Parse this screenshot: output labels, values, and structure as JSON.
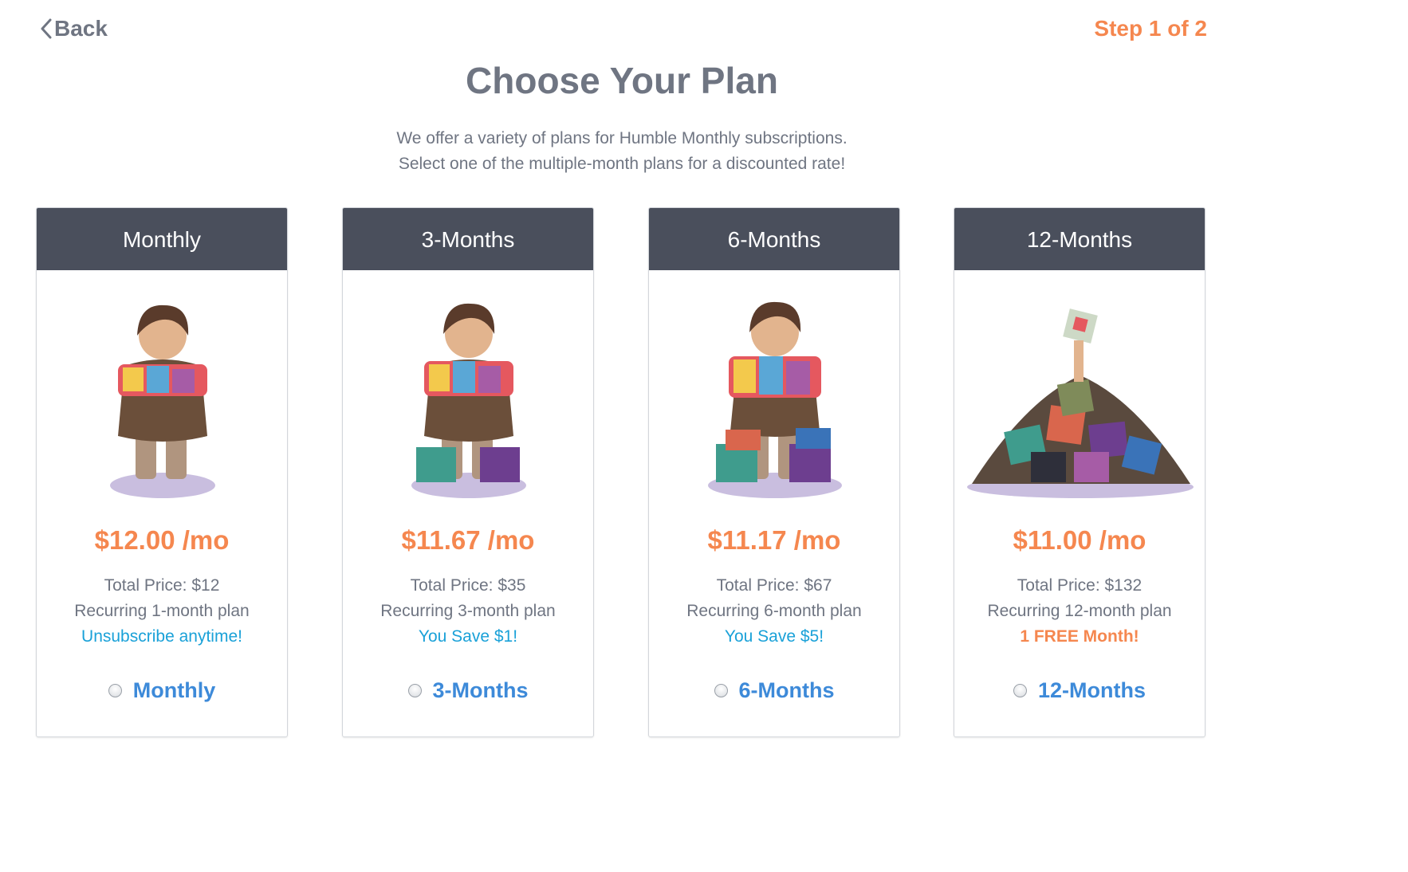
{
  "nav": {
    "back_label": "Back",
    "step_label": "Step 1 of 2"
  },
  "header": {
    "title": "Choose Your Plan",
    "subtitle_line1": "We offer a variety of plans for Humble Monthly subscriptions.",
    "subtitle_line2": "Select one of the multiple-month plans for a discounted rate!"
  },
  "colors": {
    "accent_orange": "#f5874f",
    "link_blue": "#1aa1d8",
    "radio_label_blue": "#3d8ad9",
    "card_header": "#4a4f5c",
    "text_gray": "#6f7582"
  },
  "plans": [
    {
      "name": "Monthly",
      "price": "$12.00 /mo",
      "total": "Total Price: $12",
      "recurring": "Recurring 1-month plan",
      "perk": "Unsubscribe anytime!",
      "radio_label": "Monthly",
      "image": "character-holding-games-icon"
    },
    {
      "name": "3-Months",
      "price": "$11.67 /mo",
      "total": "Total Price: $35",
      "recurring": "Recurring 3-month plan",
      "perk": "You Save $1!",
      "radio_label": "3-Months",
      "image": "character-with-game-stack-icon"
    },
    {
      "name": "6-Months",
      "price": "$11.17 /mo",
      "total": "Total Price: $67",
      "recurring": "Recurring 6-month plan",
      "perk": "You Save $5!",
      "radio_label": "6-Months",
      "image": "character-with-large-game-stack-icon"
    },
    {
      "name": "12-Months",
      "price": "$11.00 /mo",
      "total": "Total Price: $132",
      "recurring": "Recurring 12-month plan",
      "perk": "1 FREE Month!",
      "radio_label": "12-Months",
      "image": "game-pile-icon"
    }
  ]
}
